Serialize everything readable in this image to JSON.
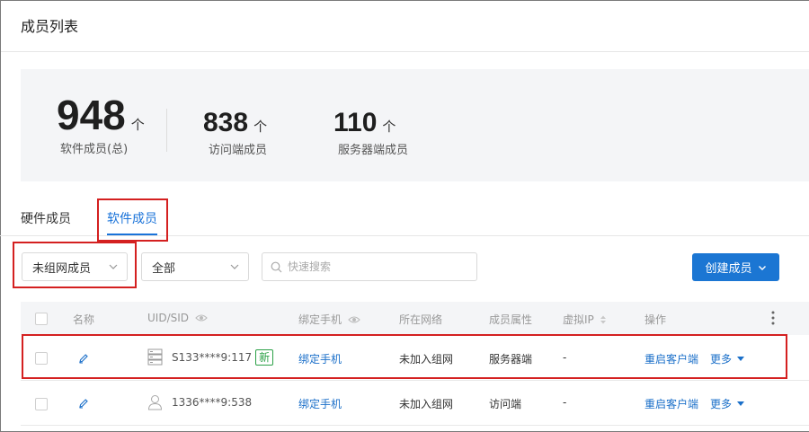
{
  "header": {
    "title": "成员列表"
  },
  "stats": {
    "total": {
      "value": "948",
      "unit": "个",
      "label": "软件成员(总)"
    },
    "access": {
      "value": "838",
      "unit": "个",
      "label": "访问端成员"
    },
    "server": {
      "value": "110",
      "unit": "个",
      "label": "服务器端成员"
    }
  },
  "tabs": [
    {
      "label": "硬件成员",
      "active": false
    },
    {
      "label": "软件成员",
      "active": true
    }
  ],
  "filters": {
    "group_select": {
      "value": "未组网成员"
    },
    "type_select": {
      "value": "全部"
    },
    "search": {
      "placeholder": "快速搜索",
      "value": ""
    },
    "create_button": {
      "label": "创建成员"
    }
  },
  "table": {
    "columns": [
      "名称",
      "UID/SID",
      "绑定手机",
      "所在网络",
      "成员属性",
      "虚拟IP",
      "操作"
    ],
    "rows": [
      {
        "uid": "S133****9:117",
        "badge": "新",
        "icon": "server-icon",
        "phone": "绑定手机",
        "network": "未加入组网",
        "attr": "服务器端",
        "vip": "-",
        "action": "重启客户端",
        "more": "更多"
      },
      {
        "uid": "1336****9:538",
        "badge": "",
        "icon": "user-icon",
        "phone": "绑定手机",
        "network": "未加入组网",
        "attr": "访问端",
        "vip": "-",
        "action": "重启客户端",
        "more": "更多"
      }
    ]
  },
  "colors": {
    "accent": "#1b76d3",
    "highlight": "#d42020",
    "badge": "#2aa046"
  }
}
